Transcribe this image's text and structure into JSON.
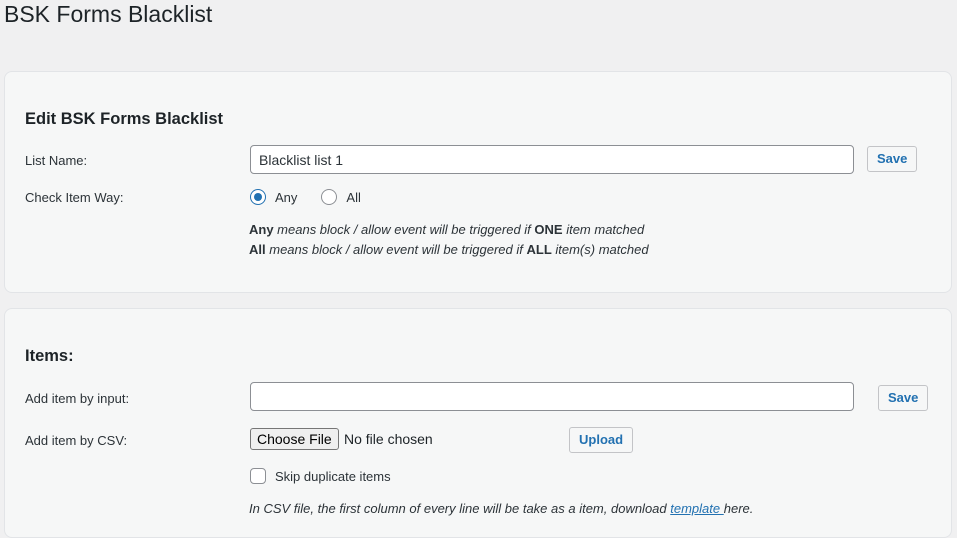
{
  "page": {
    "title": "BSK Forms Blacklist"
  },
  "edit_section": {
    "title": "Edit BSK Forms Blacklist",
    "list_name_label": "List Name:",
    "list_name_value": "Blacklist list 1",
    "save_label": "Save",
    "check_way_label": "Check Item Way:",
    "radio_options": [
      {
        "label": "Any",
        "checked": true
      },
      {
        "label": "All",
        "checked": false
      }
    ],
    "hint_any": {
      "strong": "Any",
      "text": " means block / allow event will be triggered if ",
      "strong2": "ONE",
      "text2": " item matched"
    },
    "hint_all": {
      "strong": "All",
      "text": " means block / allow event will be triggered if ",
      "strong2": "ALL",
      "text2": " item(s) matched"
    }
  },
  "items_section": {
    "title": "Items:",
    "input_label": "Add item by input:",
    "input_value": "",
    "save_label": "Save",
    "csv_label": "Add item by CSV:",
    "choose_file_label": "Choose File",
    "file_status": "No file chosen",
    "upload_label": "Upload",
    "skip_duplicates_label": "Skip duplicate items",
    "csv_note_text": "In CSV file, the first column of every line will be take as a item, download ",
    "csv_note_link": "template ",
    "csv_note_tail": "here."
  },
  "colors": {
    "accent": "#2271b1",
    "background": "#f0f0f1",
    "panel": "#f6f7f7"
  }
}
